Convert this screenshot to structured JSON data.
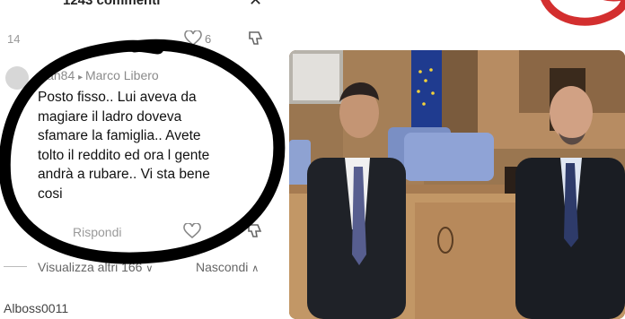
{
  "comments_panel": {
    "title": "1243 commenti",
    "previous_comment_count": "14",
    "previous_like_count": "6",
    "comment": {
      "username": "Dan84",
      "reply_to": "Marco Libero",
      "text_lines": [
        "Posto fisso.. Lui aveva da",
        "magiare il ladro doveva",
        "sfamare la famiglia.. Avete",
        "tolto il reddito ed ora l gente",
        "andrà a rubare.. Vi sta bene",
        "cosi"
      ],
      "reply_label": "Rispondi"
    },
    "view_more_label": "Visualizza altri 166",
    "hide_label": "Nascondi",
    "next_username": "Alboss0011"
  },
  "colors": {
    "annotation_circle": "#000000",
    "logo_arc": "#d32f2f",
    "eu_flag": "#1f3b8f"
  },
  "icons": [
    "close-icon",
    "heart-icon",
    "dislike-icon",
    "chevron-down-icon",
    "chevron-up-icon",
    "reply-arrow-icon"
  ]
}
